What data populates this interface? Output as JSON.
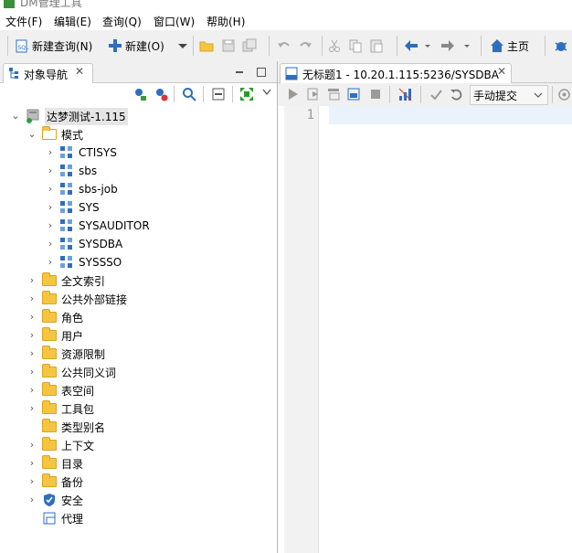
{
  "window": {
    "title": "DM管理工具"
  },
  "menu": [
    "文件(F)",
    "编辑(E)",
    "查询(Q)",
    "窗口(W)",
    "帮助(H)"
  ],
  "toolbar": {
    "new_query": "新建查询(N)",
    "new": "新建(O)",
    "home": "主页"
  },
  "navigator": {
    "tab_title": "对象导航",
    "tab_close": "✕",
    "root": "达梦测试-1.115",
    "schema_folder": "模式",
    "schemas": [
      "CTISYS",
      "sbs",
      "sbs-job",
      "SYS",
      "SYSAUDITOR",
      "SYSDBA",
      "SYSSSO"
    ],
    "folders": [
      "全文索引",
      "公共外部链接",
      "角色",
      "用户",
      "资源限制",
      "公共同义词",
      "表空间",
      "工具包",
      "类型别名",
      "上下文",
      "目录",
      "备份",
      "安全",
      "代理"
    ]
  },
  "editor": {
    "tab_title": "无标题1 - 10.20.1.115:5236/SYSDBA",
    "tab_close": "✕",
    "commit_mode": "手动提交",
    "line_numbers": [
      "1"
    ]
  },
  "colors": {
    "accent": "#2f6ebd",
    "folder": "#f5c542",
    "current_line": "#eaf2fb"
  }
}
